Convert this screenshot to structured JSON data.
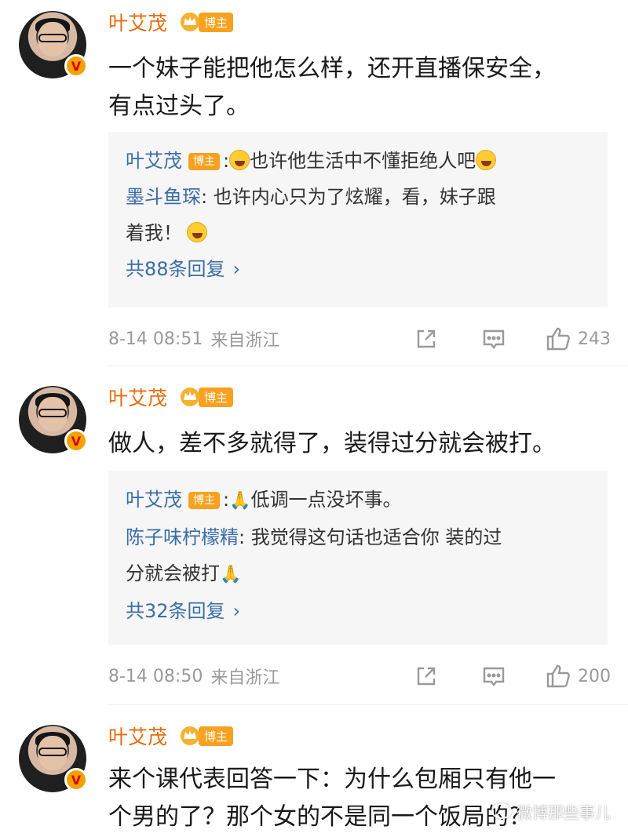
{
  "comments": [
    {
      "username": "叶艾茂",
      "badge": "博主",
      "text_lines": [
        "一个妹子能把他怎么样，还开直播保安全，",
        "有点过头了。"
      ],
      "replies": [
        {
          "name": "叶艾茂",
          "badge": "博主",
          "sep": ":",
          "text": "也许他生活中不懂拒绝人吧"
        },
        {
          "name": "墨斗鱼琛",
          "sep": ":",
          "text": " 也许内心只为了炫耀，看，妹子跟",
          "text2": "着我！"
        }
      ],
      "more_replies": "共88条回复",
      "time": "8-14 08:51",
      "location": "来自浙江",
      "likes": "243"
    },
    {
      "username": "叶艾茂",
      "badge": "博主",
      "text_lines": [
        "做人，差不多就得了，装得过分就会被打。"
      ],
      "replies": [
        {
          "name": "叶艾茂",
          "badge": "博主",
          "sep": ":",
          "text": "低调一点没坏事。"
        },
        {
          "name": "陈子味柠檬精",
          "sep": ":",
          "text": " 我觉得这句话也适合你 装的过",
          "text2": "分就会被打"
        }
      ],
      "more_replies": "共32条回复",
      "time": "8-14 08:50",
      "location": "来自浙江",
      "likes": "200"
    },
    {
      "username": "叶艾茂",
      "badge": "博主",
      "text_lines": [
        "来个课代表回答一下：为什么包厢只有他一",
        "个男的了？那个女的不是同一个饭局的？"
      ]
    }
  ],
  "watermark": "微博那些事儿",
  "icons": {
    "avatar_badge": "V",
    "share": "share-icon",
    "comment": "comment-icon",
    "like": "thumbs-up-icon",
    "chevron": "›"
  },
  "colors": {
    "username": "#e86b0c",
    "reply_name": "#3a6da8",
    "badge": "#f7a11f",
    "meta": "#9a9a9a"
  }
}
